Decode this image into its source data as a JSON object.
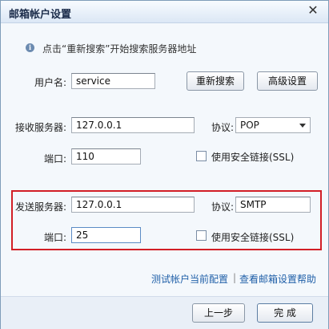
{
  "window": {
    "title": "邮箱帐户设置",
    "close_glyph": "✕"
  },
  "hint": {
    "icon": "i",
    "text": "点击“重新搜索”开始搜索服务器地址"
  },
  "username": {
    "label": "用户名:",
    "value": "service"
  },
  "buttons": {
    "research": "重新搜索",
    "advanced": "高级设置",
    "prev": "上一步",
    "finish": "完 成"
  },
  "incoming": {
    "server_label": "接收服务器:",
    "server_value": "127.0.0.1",
    "protocol_label": "协议:",
    "protocol_value": "POP",
    "port_label": "端口:",
    "port_value": "110",
    "ssl_label": "使用安全链接(SSL)"
  },
  "outgoing": {
    "server_label": "发送服务器:",
    "server_value": "127.0.0.1",
    "protocol_label": "协议:",
    "protocol_value": "SMTP",
    "port_label": "端口:",
    "port_value": "25",
    "ssl_label": "使用安全链接(SSL)"
  },
  "links": {
    "test": "测试帐户当前配置",
    "separator": "|",
    "help": "查看邮箱设置帮助"
  },
  "colors": {
    "highlight_border": "#d21f26",
    "link": "#1f5fa8"
  }
}
